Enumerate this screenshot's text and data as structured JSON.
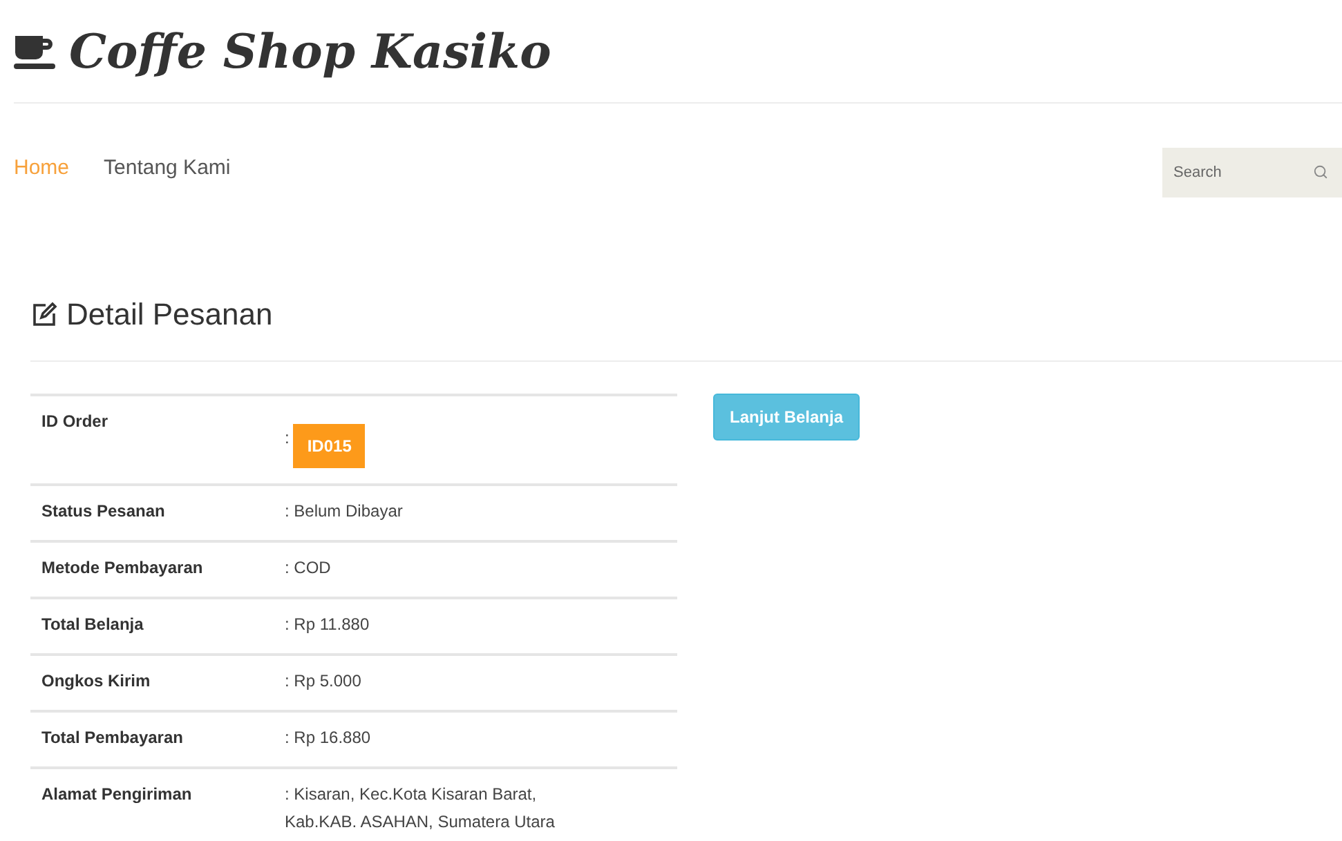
{
  "brand": {
    "title": "Coffe Shop Kasiko"
  },
  "nav": [
    {
      "label": "Home",
      "selected": true
    },
    {
      "label": "Tentang Kami",
      "selected": false
    }
  ],
  "search": {
    "placeholder": "Search"
  },
  "heading": "Detail Pesanan",
  "order_details": [
    {
      "label": "ID Order",
      "kind": "badge",
      "separator": ":",
      "value": "ID015"
    },
    {
      "label": "Status Pesanan",
      "kind": "text",
      "value": ": Belum Dibayar"
    },
    {
      "label": "Metode Pembayaran",
      "kind": "text",
      "value": ": COD"
    },
    {
      "label": "Total Belanja",
      "kind": "text",
      "value": ": Rp 11.880"
    },
    {
      "label": "Ongkos Kirim",
      "kind": "text",
      "value": ": Rp 5.000"
    },
    {
      "label": "Total Pembayaran",
      "kind": "text",
      "value": ": Rp 16.880"
    },
    {
      "label": "Alamat Pengiriman",
      "kind": "text",
      "value": ": Kisaran, Kec.Kota Kisaran Barat,\nKab.KAB. ASAHAN, Sumatera Utara"
    }
  ],
  "continue_button": "Lanjut Belanja"
}
